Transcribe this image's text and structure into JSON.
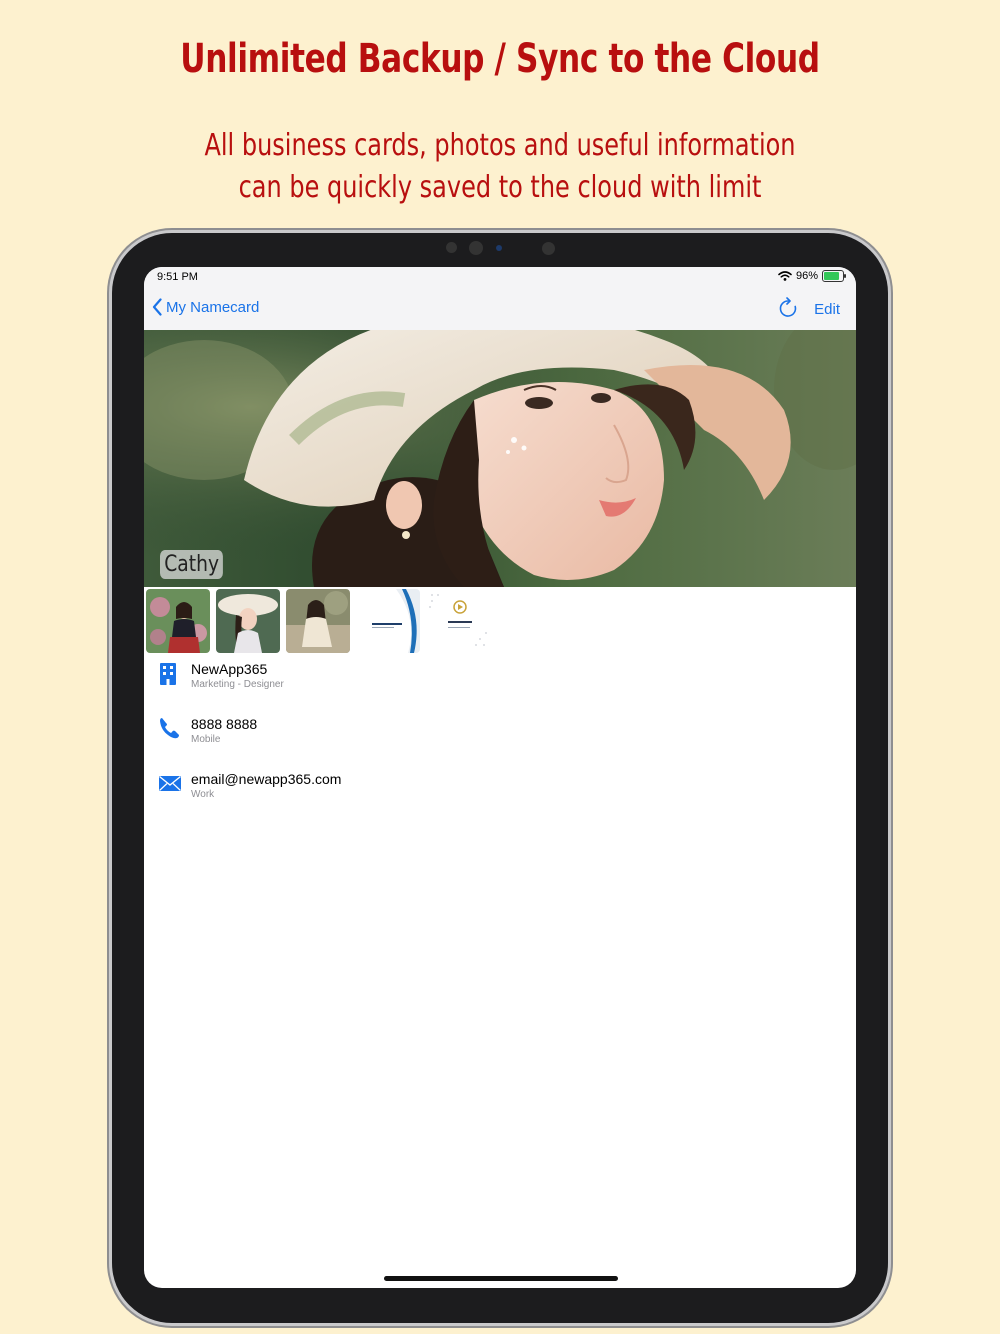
{
  "banner": {
    "headline": "Unlimited Backup / Sync to the Cloud",
    "subline_1": "All business cards, photos and useful information",
    "subline_2": "can be quickly saved to the cloud with limit"
  },
  "status_bar": {
    "time": "9:51 PM",
    "battery_percent": "96%",
    "battery_level": 0.96
  },
  "nav": {
    "back_label": "My Namecard",
    "edit_label": "Edit"
  },
  "profile": {
    "name": "Cathy"
  },
  "thumbnails": [
    {
      "kind": "photo",
      "icon": "photo-thumbnail-1"
    },
    {
      "kind": "photo",
      "icon": "photo-thumbnail-2"
    },
    {
      "kind": "photo",
      "icon": "photo-thumbnail-3"
    },
    {
      "kind": "card",
      "icon": "business-card-thumbnail-1"
    },
    {
      "kind": "card",
      "icon": "business-card-thumbnail-2"
    }
  ],
  "contact": {
    "company": {
      "value": "NewApp365",
      "detail": "Marketing - Designer",
      "icon": "building-icon"
    },
    "phone": {
      "value": "8888 8888",
      "detail": "Mobile",
      "icon": "phone-icon"
    },
    "email": {
      "value": "email@newapp365.com",
      "detail": "Work",
      "icon": "mail-icon"
    }
  },
  "colors": {
    "accent": "#1a73e8",
    "banner_text": "#b80f0f",
    "background": "#fdf1cf"
  }
}
